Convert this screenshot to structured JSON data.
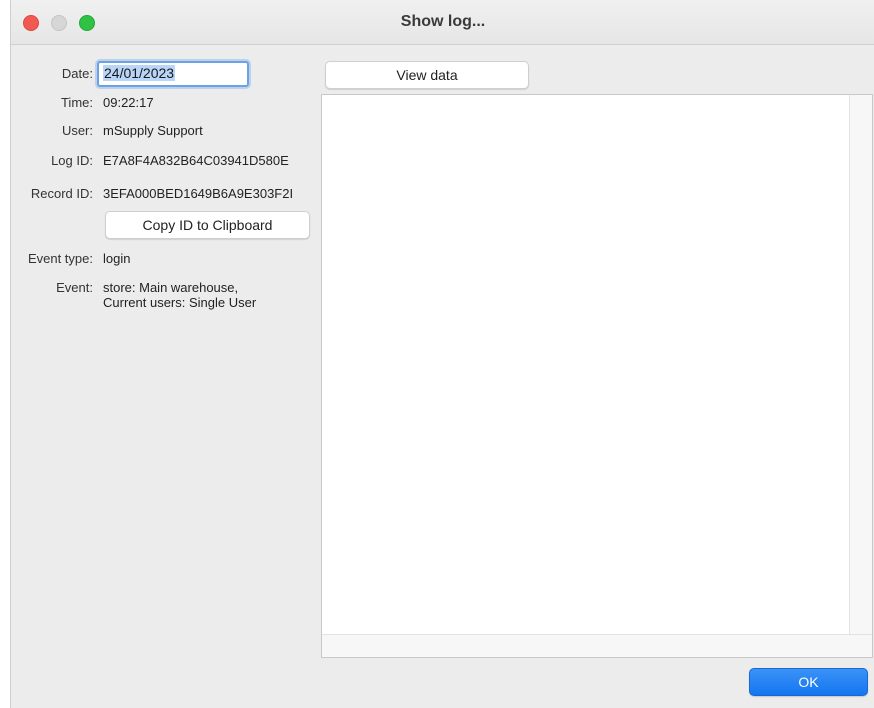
{
  "window": {
    "title": "Show log..."
  },
  "fields": {
    "date_label": "Date:",
    "date_value": "24/01/2023",
    "time_label": "Time:",
    "time_value": "09:22:17",
    "user_label": "User:",
    "user_value": "mSupply Support",
    "logid_label": "Log ID:",
    "logid_value": "E7A8F4A832B64C03941D580E",
    "recordid_label": "Record ID:",
    "recordid_value": "3EFA000BED1649B6A9E303F2I",
    "eventtype_label": "Event type:",
    "eventtype_value": "login",
    "event_label": "Event:",
    "event_value": "store: Main warehouse, Current users: Single User"
  },
  "buttons": {
    "copy_id": "Copy ID to Clipboard",
    "view_data": "View data",
    "ok": "OK"
  },
  "colors": {
    "ok_button": "#1476f0",
    "close_light": "#f05a52",
    "zoom_light": "#2fc245",
    "focus_ring": "#6aa1e8"
  }
}
